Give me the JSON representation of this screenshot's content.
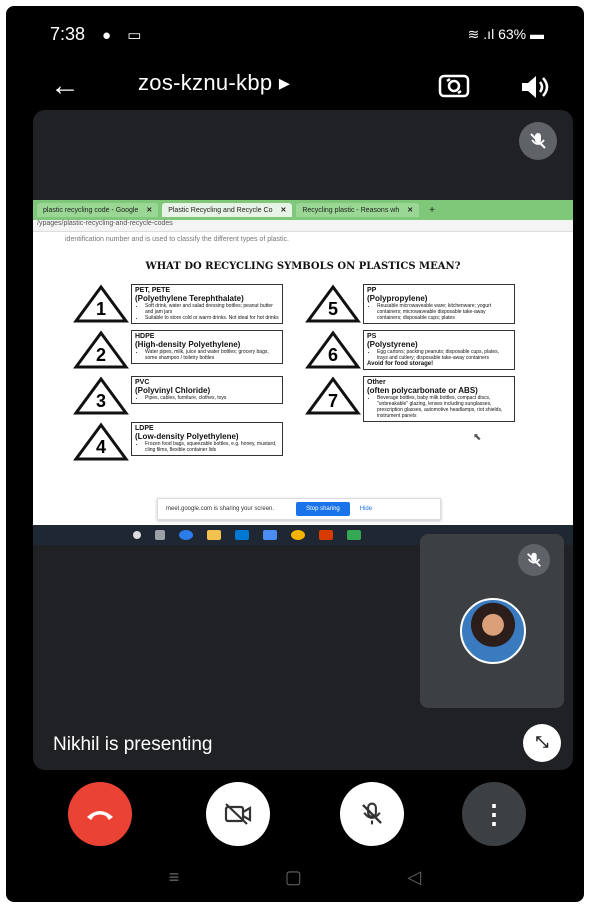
{
  "status_bar": {
    "time": "7:38",
    "battery": "63%"
  },
  "header": {
    "meeting_code": "zos-kznu-kbp ▸"
  },
  "shared_screen": {
    "tabs": [
      {
        "label": "plastic recycling code - Google",
        "close": "✕"
      },
      {
        "label": "Plastic Recycling and Recycle Co",
        "close": "✕"
      },
      {
        "label": "Recycling plastic - Reasons wh",
        "close": "✕"
      }
    ],
    "tab_plus": "+",
    "url": "/ypages/plastic-recycling-and-recycle-codes",
    "intro": "identification number and is used to classify the different types of plastic.",
    "title": "WHAT DO RECYCLING SYMBOLS ON PLASTICS MEAN?",
    "codes": [
      {
        "num": "1",
        "abbr": "PET, PETE",
        "name": "(Polyethylene Terephthalate)",
        "items": [
          "Soft drink, water and salad dressing bottles; peanut butter and jam jars",
          "Suitable to store cold or warm drinks. Not ideal for hot drinks"
        ],
        "note": ""
      },
      {
        "num": "2",
        "abbr": "HDPE",
        "name": "(High-density Polyethylene)",
        "items": [
          "Water pipes, milk, juice and water bottles; grocery bags, some shampoo / toiletry bottles"
        ],
        "note": ""
      },
      {
        "num": "3",
        "abbr": "PVC",
        "name": "(Polyvinyl Chloride)",
        "items": [
          "Pipes, cables, furniture, clothes, toys"
        ],
        "note": ""
      },
      {
        "num": "4",
        "abbr": "LDPE",
        "name": "(Low-density Polyethylene)",
        "items": [
          "Frozen food bags, squeezable bottles, e.g. honey, mustard, cling films, flexible container lids"
        ],
        "note": ""
      },
      {
        "num": "5",
        "abbr": "PP",
        "name": "(Polypropylene)",
        "items": [
          "Reusable microwaveable ware; kitchenware; yogurt containers; microwaveable disposable take-away containers; disposable cups; plates"
        ],
        "note": ""
      },
      {
        "num": "6",
        "abbr": "PS",
        "name": "(Polystyrene)",
        "items": [
          "Egg cartons; packing peanuts; disposable cups, plates, trays and cutlery; disposable take-away containers"
        ],
        "note": "Avoid for food storage!"
      },
      {
        "num": "7",
        "abbr": "Other",
        "name": "(often polycarbonate or ABS)",
        "items": [
          "Beverage bottles, baby milk bottles, compact discs, \"unbreakable\" glazing, lenses including sunglasses, prescription glasses, automotive headlamps, riot shields, instrument panels"
        ],
        "note": ""
      }
    ],
    "sharing_notice": "meet.google.com is sharing your screen.",
    "stop_sharing": "Stop sharing",
    "hide": "Hide"
  },
  "presenting_text": "Nikhil is presenting",
  "colors": {
    "end_call": "#ea4335",
    "tab_bar": "#7fc87a",
    "stop_sharing": "#1a73e8"
  },
  "icons": {
    "back": "back-arrow-icon",
    "switch_camera": "switch-camera-icon",
    "speaker": "speaker-icon",
    "mic_off": "mic-off-icon",
    "end_call": "phone-hangup-icon",
    "camera_off": "video-off-icon",
    "more": "more-vert-icon",
    "collapse": "collapse-icon"
  }
}
